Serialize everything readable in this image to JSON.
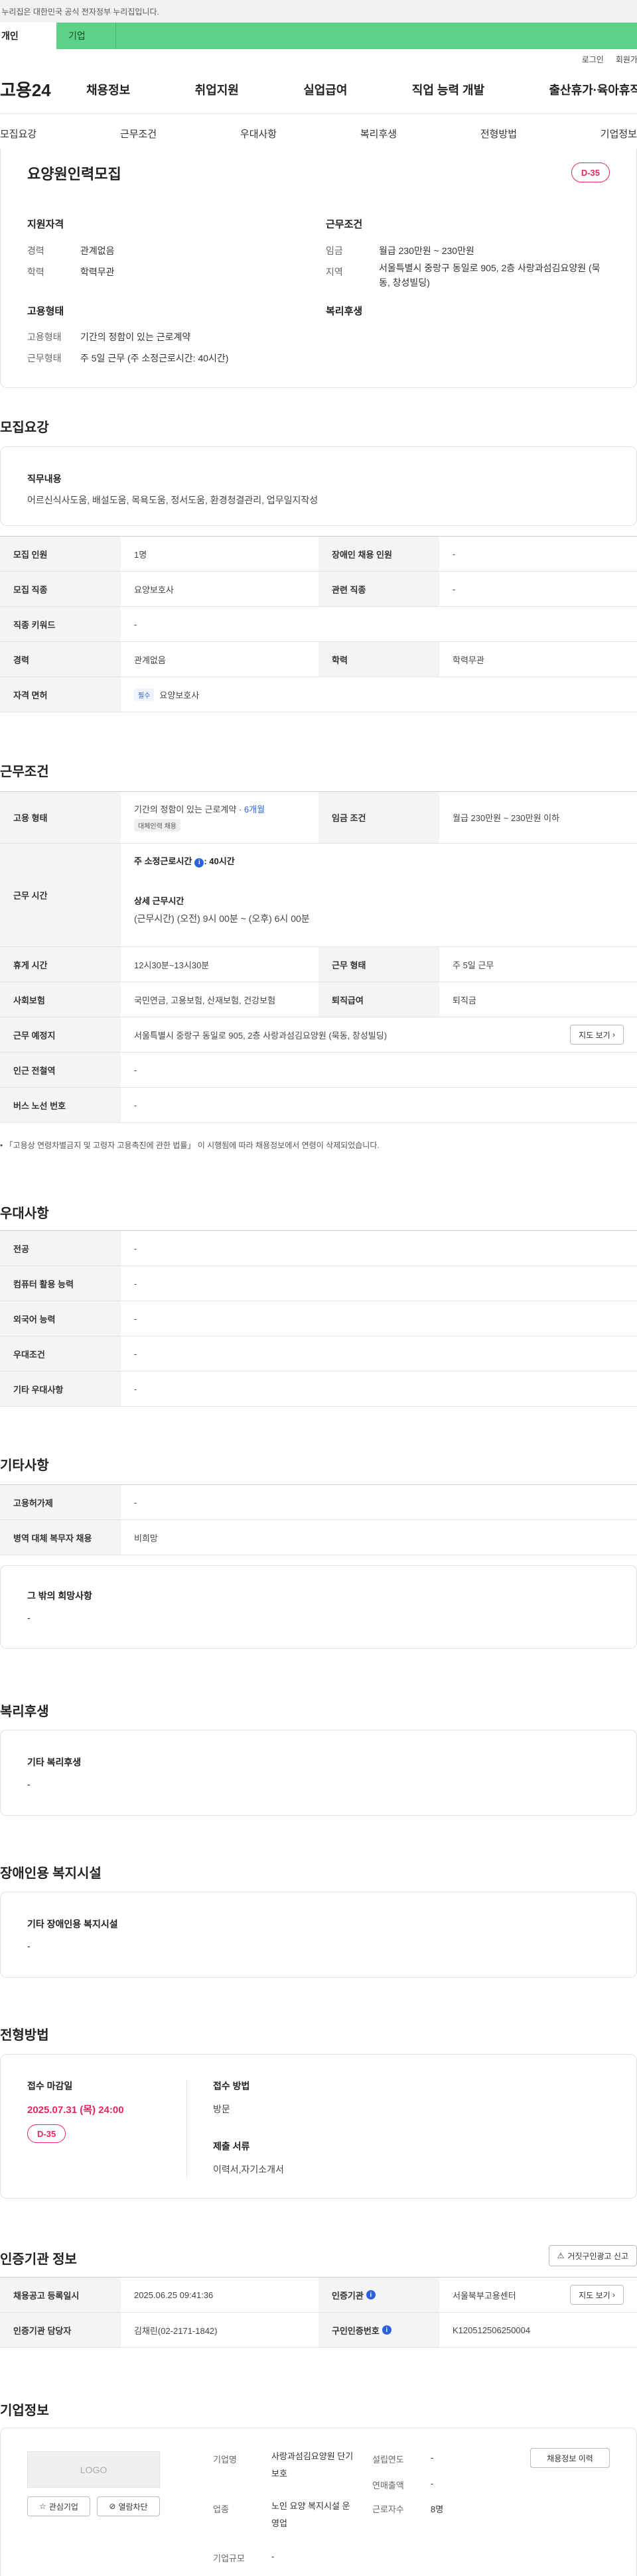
{
  "notice": "이 누리집은 대한민국 공식 전자정부 누리집입니다.",
  "user_tabs": {
    "personal": "개인",
    "corp": "기업"
  },
  "util": {
    "login": "로그인",
    "join": "회원가입"
  },
  "logo": "고용24",
  "gnb": [
    "채용정보",
    "취업지원",
    "실업급여",
    "직업 능력 개발",
    "출산휴가·육아휴직"
  ],
  "subtabs": [
    "모집요강",
    "근무조건",
    "우대사항",
    "복리후생",
    "전형방법",
    "기업정보"
  ],
  "summary": {
    "title": "요양원인력모집",
    "dday": "D-35",
    "qual_title": "지원자격",
    "qual": [
      {
        "label": "경력",
        "value": "관계없음"
      },
      {
        "label": "학력",
        "value": "학력무관"
      }
    ],
    "cond_title": "근무조건",
    "cond": [
      {
        "label": "임금",
        "value": "월급 230만원 ~ 230만원"
      },
      {
        "label": "지역",
        "value": "서울특별시 중랑구 동일로 905, 2층 사랑과섬김요양원 (묵동, 창성빌딩)"
      }
    ],
    "emp_title": "고용형태",
    "emp": [
      {
        "label": "고용형태",
        "value": "기간의 정함이 있는 근로계약"
      },
      {
        "label": "근무형태",
        "value": "주 5일 근무 (주 소정근로시간: 40시간)"
      }
    ],
    "welfare_title": "복리후생"
  },
  "recruit": {
    "title": "모집요강",
    "duty_title": "직무내용",
    "duty": "어르신식사도움, 배설도움, 목욕도움, 정서도움, 환경청결관리, 업무일지작성",
    "rows": [
      {
        "h1": "모집 인원",
        "v1": "1명",
        "h2": "장애인 채용 인원",
        "v2": "-"
      },
      {
        "h1": "모집 직종",
        "v1": "요양보호사",
        "h2": "관련 직종",
        "v2": "-"
      },
      {
        "h1": "직종 키워드",
        "v1": "-"
      },
      {
        "h1": "경력",
        "v1": "관계없음",
        "h2": "학력",
        "v2": "학력무관"
      },
      {
        "h1": "자격 면허",
        "badge": "필수",
        "v1": "요양보호사"
      }
    ]
  },
  "work": {
    "title": "근무조건",
    "emp_h": "고용 형태",
    "emp_v": "기간의 정함이 있는 근로계약 · ",
    "emp_period": "6개월",
    "emp_badge": "대체인력 채용",
    "wage_h": "임금 조건",
    "wage_v": "월급 230만원 ~ 230만원 이하",
    "time_h": "근무 시간",
    "weekly_label": "주 소정근로시간",
    "weekly_value": "40시간",
    "detail_label": "상세 근무시간",
    "detail_value": "(근무시간) (오전) 9시 00분 ~ (오후) 6시 00분",
    "rest_h": "휴게 시간",
    "rest_v": "12시30분~13시30분",
    "form_h": "근무 형태",
    "form_v": "주 5일 근무",
    "ins_h": "사회보험",
    "ins_v": "국민연금, 고용보험, 산재보험, 건강보험",
    "ret_h": "퇴직급여",
    "ret_v": "퇴직금",
    "place_h": "근무 예정지",
    "place_v": "서울특별시 중랑구 동일로 905, 2층 사랑과섬김요양원 (묵동, 창성빌딩)",
    "map_btn": "지도 보기",
    "subway_h": "인근 전철역",
    "subway_v": "-",
    "bus_h": "버스 노선 번호",
    "bus_v": "-",
    "note": "「고용상 연령차별금지 및 고령자 고용촉진에 관한 법률」 이 시행됨에 따라 채용정보에서 연령이 삭제되었습니다."
  },
  "pref": {
    "title": "우대사항",
    "rows": [
      {
        "h": "전공",
        "v": "-"
      },
      {
        "h": "컴퓨터 활용 능력",
        "v": "-"
      },
      {
        "h": "외국어 능력",
        "v": "-"
      },
      {
        "h": "우대조건",
        "v": "-"
      },
      {
        "h": "기타 우대사항",
        "v": "-"
      }
    ]
  },
  "etc": {
    "title": "기타사항",
    "rows": [
      {
        "h": "고용허가제",
        "v": "-"
      },
      {
        "h": "병역 대체 복무자 채용",
        "v": "비희망"
      }
    ],
    "other_title": "그 밖의 희망사항",
    "other_v": "-"
  },
  "welfare": {
    "title": "복리후생",
    "sub": "기타 복리후생",
    "v": "-"
  },
  "disabled": {
    "title": "장애인용 복지시설",
    "sub": "기타 장애인용 복지시설",
    "v": "-"
  },
  "selection": {
    "title": "전형방법",
    "deadline_label": "접수 마감일",
    "deadline": "2025.07.31 (목) 24:00",
    "dday": "D-35",
    "method_label": "접수 방법",
    "method": "방문",
    "docs_label": "제출 서류",
    "docs": "이력서,자기소개서"
  },
  "cert": {
    "title": "인증기관 정보",
    "report_btn": "거짓구인광고 신고",
    "rows": [
      {
        "h1": "채용공고 등록일시",
        "v1": "2025.06.25 09:41:36",
        "h2": "인증기관",
        "v2": "서울북부고용센터",
        "btn": "지도 보기"
      },
      {
        "h1": "인증기관 담당자",
        "v1": "김채린(02-2171-1842)",
        "h2": "구인인증번호",
        "v2": "K120512506250004"
      }
    ]
  },
  "company": {
    "title": "기업정보",
    "logo_text": "LOGO",
    "interest_btn": "관심기업",
    "block_btn": "열람차단",
    "history_btn": "채용정보 이력",
    "name_label": "기업명",
    "name": "사랑과섬김요양원 단기보호",
    "industry_label": "업종",
    "industry": "노인 요양 복지시설 운영업",
    "size_label": "기업규모",
    "size": "-",
    "year_label": "설립연도",
    "year": "-",
    "sales_label": "연매출액",
    "sales": "-",
    "emp_label": "근로자수",
    "emp": "8명"
  }
}
